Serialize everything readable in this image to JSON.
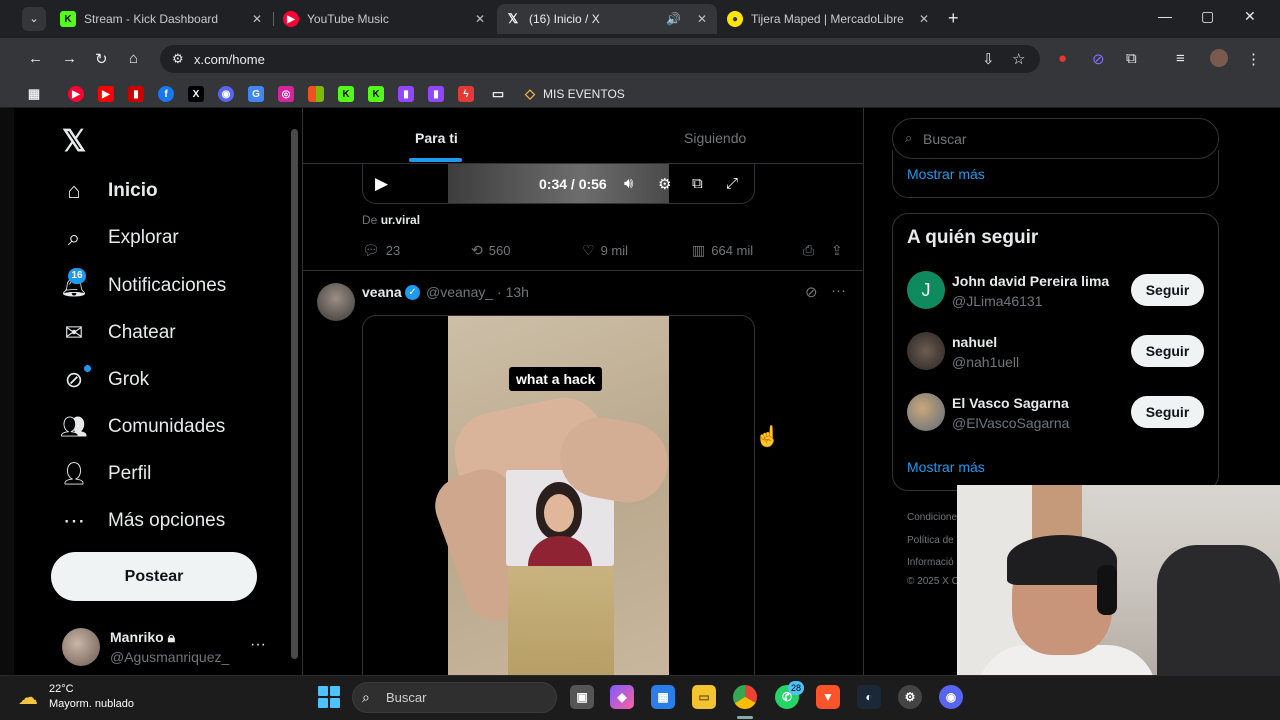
{
  "browser": {
    "tabs": [
      {
        "title": "Stream - Kick Dashboard",
        "icon": "kick-icon",
        "color": "#53fc18"
      },
      {
        "title": "YouTube Music",
        "icon": "youtube-music-icon",
        "color": "#ff0033"
      },
      {
        "title": "(16) Inicio / X",
        "icon": "x-icon",
        "color": "#ffffff",
        "active": true
      },
      {
        "title": "Tijera Maped | MercadoLibre",
        "icon": "mercadolibre-icon",
        "color": "#ffe600"
      }
    ],
    "url": "x.com/home",
    "bookmark_folder": "MIS EVENTOS"
  },
  "nav": {
    "items": [
      {
        "label": "Inicio",
        "icon": "home-icon"
      },
      {
        "label": "Explorar",
        "icon": "search-icon"
      },
      {
        "label": "Notificaciones",
        "icon": "bell-icon"
      },
      {
        "label": "Chatear",
        "icon": "mail-icon"
      },
      {
        "label": "Grok",
        "icon": "grok-icon"
      },
      {
        "label": "Comunidades",
        "icon": "people-icon"
      },
      {
        "label": "Perfil",
        "icon": "person-icon"
      },
      {
        "label": "Más opciones",
        "icon": "more-circle-icon"
      }
    ],
    "notification_count": "16",
    "post_button": "Postear",
    "account": {
      "name": "Manriko",
      "handle": "@Agusmanriquez_"
    }
  },
  "feed": {
    "tabs": [
      "Para ti",
      "Siguiendo"
    ],
    "video": {
      "time": "0:34 / 0:56"
    },
    "from_label": "De",
    "from_source": "ur.viral",
    "actions": {
      "replies": "23",
      "reposts": "560",
      "likes": "9 mil",
      "views": "664 mil"
    },
    "post": {
      "name": "veana",
      "handle": "@veanay_ · 13h",
      "caption": "what a hack"
    }
  },
  "sidebar_right": {
    "search_placeholder": "Buscar",
    "show_more": "Mostrar más",
    "who_to_follow_title": "A quién seguir",
    "suggestions": [
      {
        "name": "John david Pereira lima",
        "handle": "@JLima46131",
        "button": "Seguir",
        "avatar_letter": "J",
        "avatar_color": "#0f8a5f"
      },
      {
        "name": "nahuel",
        "handle": "@nah1uell",
        "button": "Seguir"
      },
      {
        "name": "El Vasco Sagarna",
        "handle": "@ElVascoSagarna",
        "button": "Seguir"
      }
    ],
    "show_more_2": "Mostrar más",
    "footer": [
      "Condicione",
      "Política de",
      "Informació",
      "© 2025 X C"
    ]
  },
  "taskbar": {
    "temperature": "22°C",
    "weather": "Mayorm. nublado",
    "search": "Buscar",
    "whatsapp_badge": "28"
  }
}
